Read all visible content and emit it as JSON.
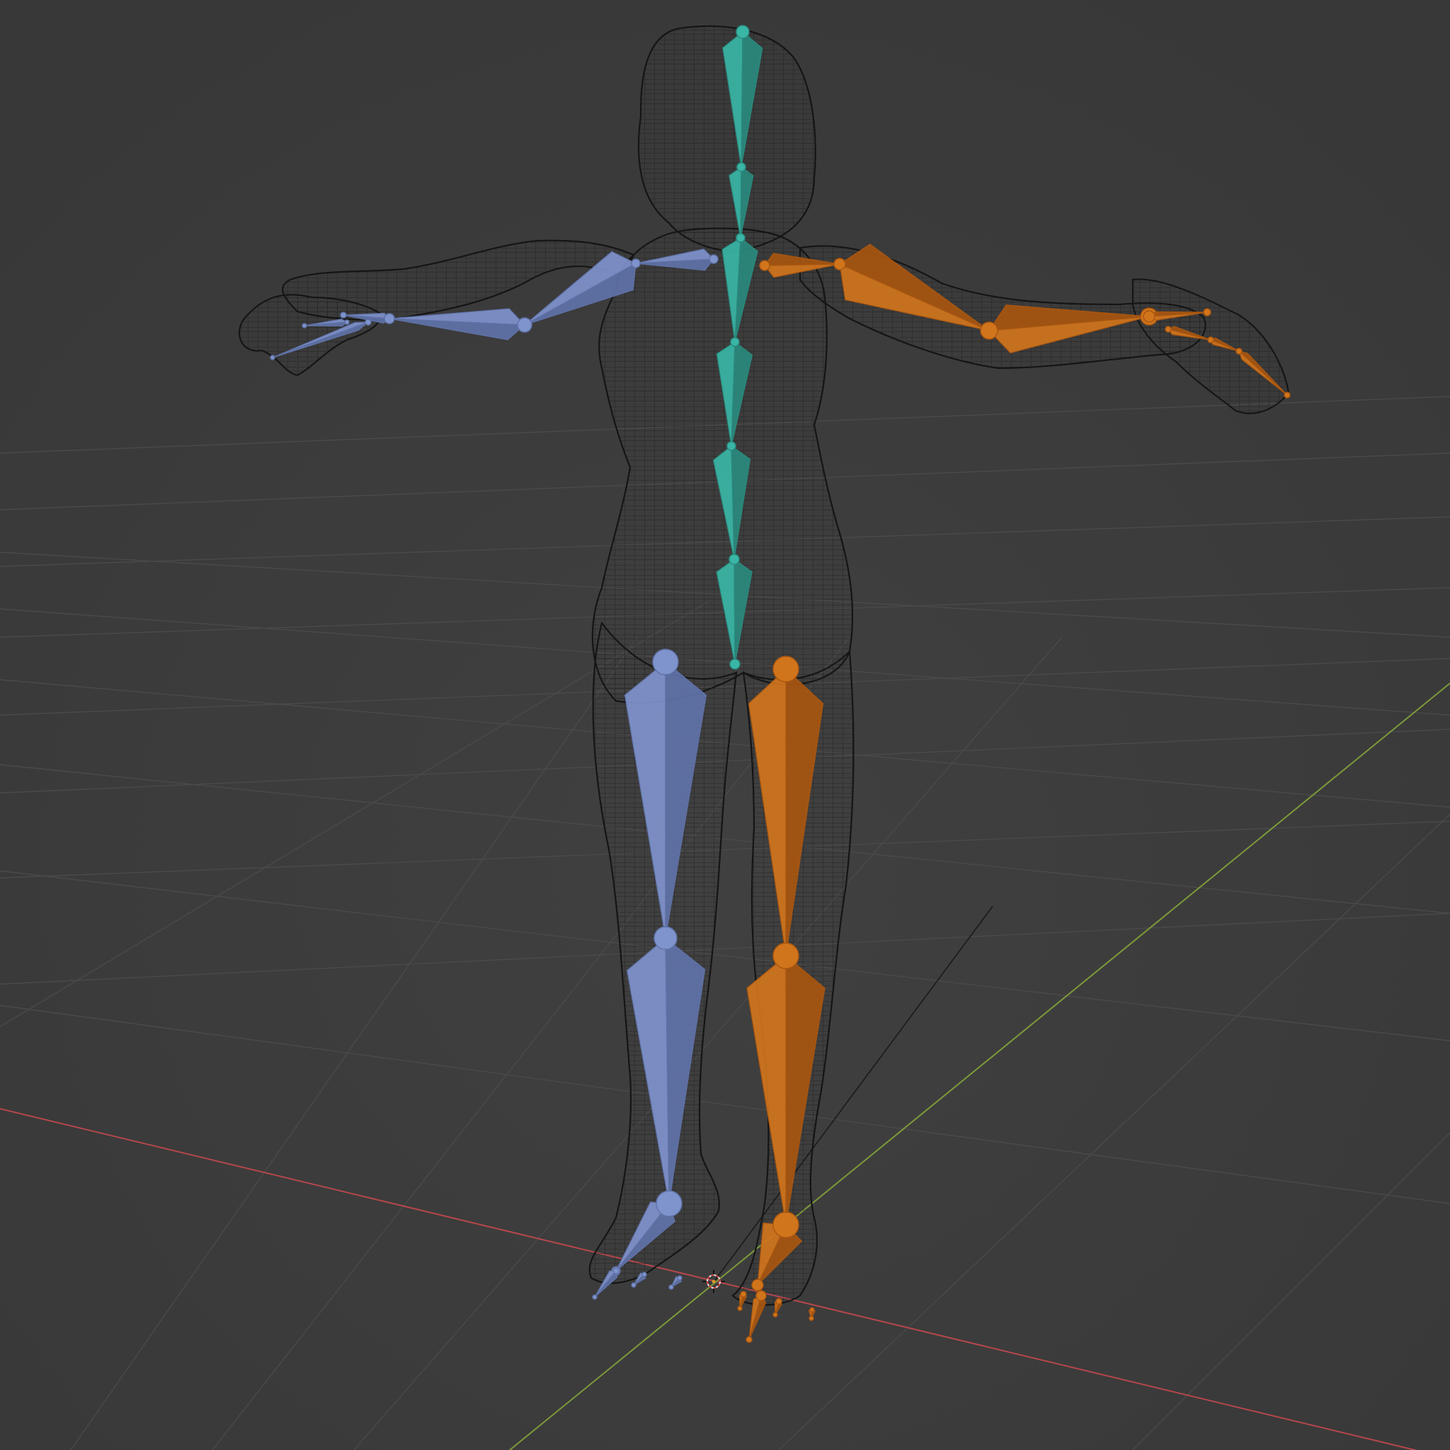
{
  "viewport": {
    "background_color": "#3d3d3d",
    "grid_line_color": "#4a4a4a",
    "x_axis_color": "#b5474c",
    "y_axis_color": "#7d9a3a"
  },
  "object": {
    "type": "armature-over-mesh",
    "mesh_display": "wireframe",
    "mesh_wire_color": "#111111",
    "pose": "T-pose"
  },
  "bone_groups": [
    {
      "name": "spine-head",
      "color": "#3ab6a6",
      "shading": "#2a8a7e"
    },
    {
      "name": "left-side",
      "color": "#7f93cc",
      "shading": "#5f72a8"
    },
    {
      "name": "right-side",
      "color": "#d1751c",
      "shading": "#a85610"
    }
  ],
  "icons": {
    "origin": "3d-cursor-icon"
  }
}
